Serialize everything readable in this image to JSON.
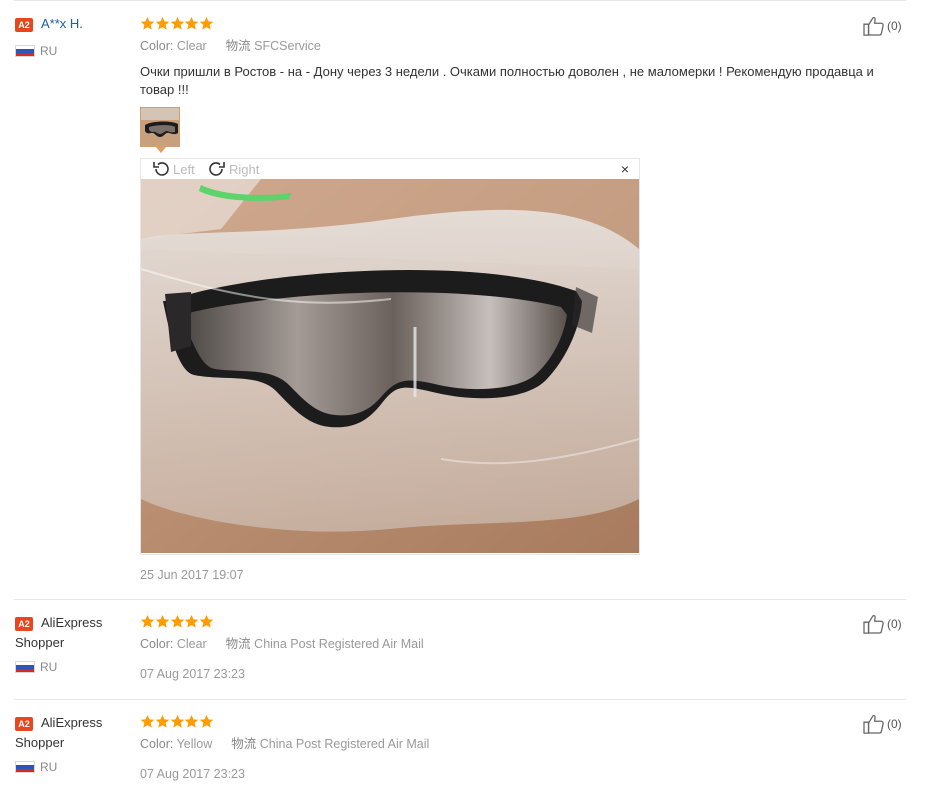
{
  "reviews": [
    {
      "badge": "A2",
      "user": "A**x H.",
      "country": "RU",
      "color_label": "Color:",
      "color_value": "Clear",
      "shipping_label": "物流",
      "shipping_value": "SFCService",
      "helpful_count": "(0)",
      "text": "Очки пришли в Ростов - на - Дону через 3 недели . Очками полностью доволен , не маломерки ! Рекомендую продавца и товар !!!",
      "date": "25 Jun 2017 19:07",
      "rating": 5
    },
    {
      "badge": "A2",
      "user": "AliExpress Shopper",
      "country": "RU",
      "color_label": "Color:",
      "color_value": "Clear",
      "shipping_label": "物流",
      "shipping_value": "China Post Registered Air Mail",
      "helpful_count": "(0)",
      "date": "07 Aug 2017 23:23",
      "rating": 5
    },
    {
      "badge": "A2",
      "user": "AliExpress Shopper",
      "country": "RU",
      "color_label": "Color:",
      "color_value": "Yellow",
      "shipping_label": "物流",
      "shipping_value": "China Post Registered Air Mail",
      "helpful_count": "(0)",
      "date": "07 Aug 2017 23:23",
      "rating": 5
    }
  ],
  "viewer": {
    "rotate_left": "Left",
    "rotate_right": "Right",
    "close": "×"
  },
  "colors": {
    "star": "#ff9c00",
    "badge": "#e8461f",
    "name_link": "#1a5ea8"
  }
}
